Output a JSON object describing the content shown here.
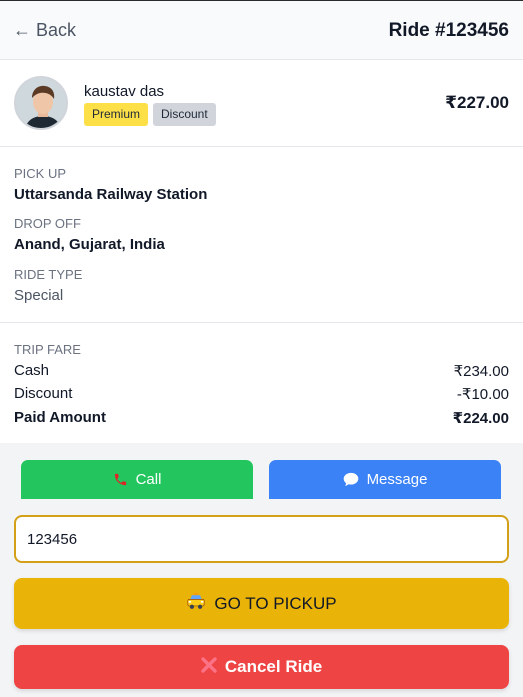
{
  "header": {
    "back_label": "← Back",
    "title": "Ride #123456"
  },
  "rider": {
    "name": "kaustav das",
    "badges": [
      "Premium",
      "Discount"
    ],
    "price": "₹227.00"
  },
  "route": {
    "pickup_label": "PICK UP",
    "pickup_value": "Uttarsanda Railway Station",
    "dropoff_label": "DROP OFF",
    "dropoff_value": "Anand, Gujarat, India",
    "ridetype_label": "RIDE TYPE",
    "ridetype_value": "Special"
  },
  "fare": {
    "section_label": "TRIP FARE",
    "rows": [
      {
        "label": "Cash",
        "value": "₹234.00"
      },
      {
        "label": "Discount",
        "value": "-₹10.00"
      },
      {
        "label": "Paid Amount",
        "value": "₹224.00"
      }
    ]
  },
  "actions": {
    "call_label": "Call",
    "message_label": "Message",
    "otp_value": "123456",
    "pickup_label": "GO TO PICKUP",
    "cancel_label": "Cancel Ride"
  },
  "icons": {
    "call": "phone-icon",
    "message": "chat-bubble-icon",
    "pickup": "taxi-icon",
    "cancel": "cross-icon"
  },
  "colors": {
    "call": "#22c55e",
    "message": "#3b82f6",
    "pickup": "#eab308",
    "cancel": "#ef4444",
    "premium_badge": "#fde047",
    "otp_border": "#d4a017"
  }
}
